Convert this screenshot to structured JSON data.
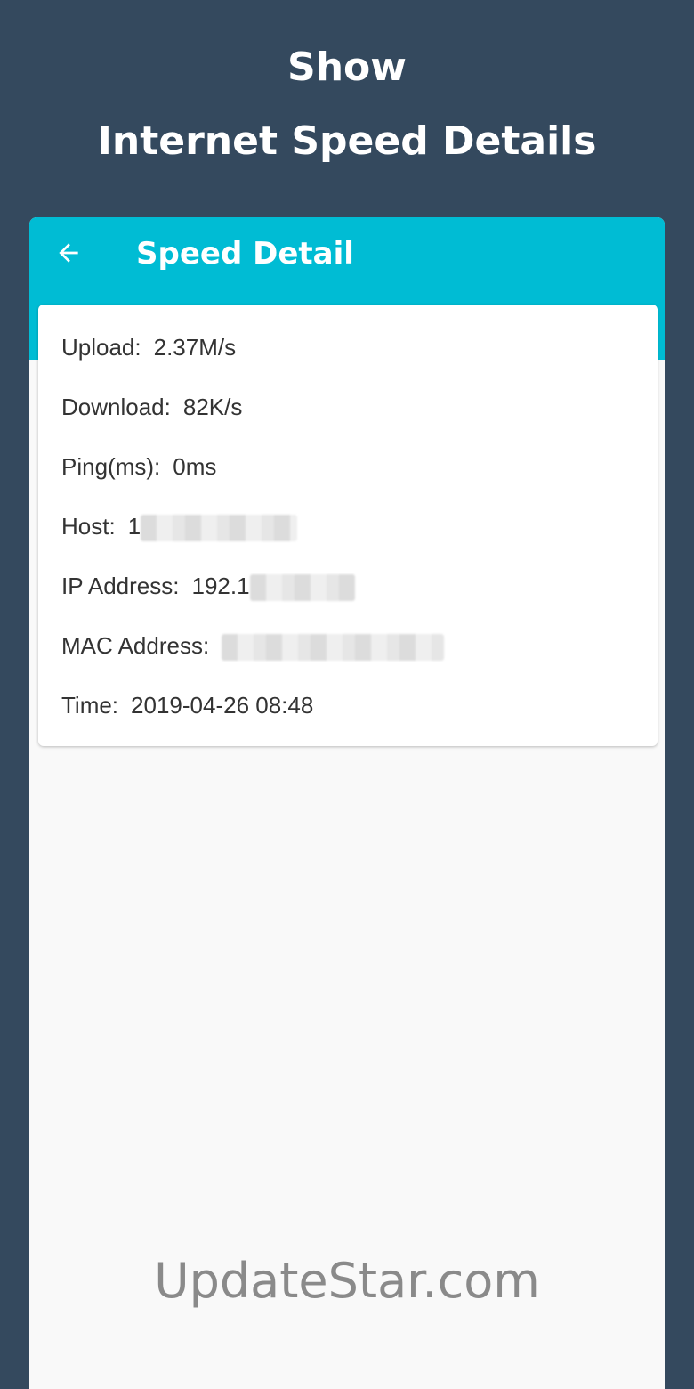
{
  "promo": {
    "line1": "Show",
    "line2": "Internet Speed Details"
  },
  "app_bar": {
    "back_icon": "arrow-left-icon",
    "title": "Speed Detail",
    "color": "#00bcd4"
  },
  "details": {
    "upload": {
      "label": "Upload:",
      "value": "2.37M/s"
    },
    "download": {
      "label": "Download:",
      "value": "82K/s"
    },
    "ping": {
      "label": "Ping(ms):",
      "value": "0ms"
    },
    "host": {
      "label": "Host:",
      "value_visible": "1"
    },
    "ip": {
      "label": "IP Address:",
      "value_visible": "192.1"
    },
    "mac": {
      "label": "MAC Address:"
    },
    "time": {
      "label": "Time:",
      "value": "2019-04-26 08:48"
    }
  },
  "watermark": "UpdateStar.com"
}
